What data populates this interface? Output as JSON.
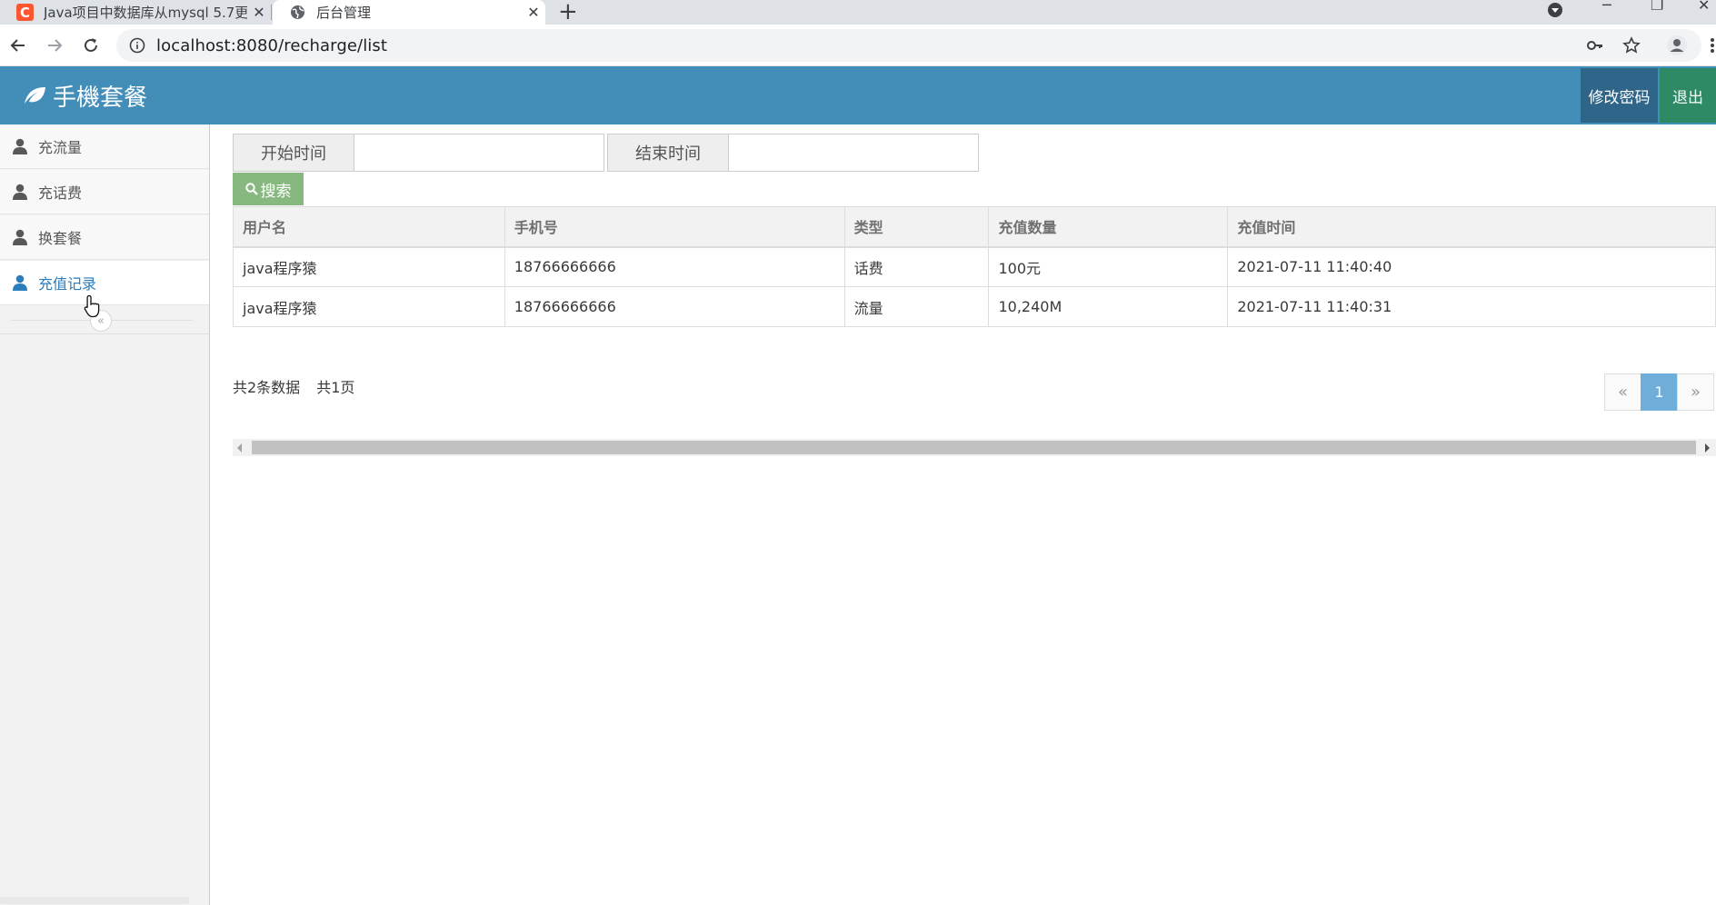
{
  "browser": {
    "tabs": [
      {
        "title": "Java项目中数据库从mysql 5.7更",
        "active": false
      },
      {
        "title": "后台管理",
        "active": true
      }
    ],
    "url": "localhost:8080/recharge/list"
  },
  "header": {
    "brand": "手機套餐",
    "change_password": "修改密码",
    "logout": "退出",
    "colors": {
      "bar": "#438eb9",
      "pwd": "#2e6589",
      "exit": "#2e8965"
    }
  },
  "sidebar": {
    "items": [
      {
        "label": "充流量",
        "active": false
      },
      {
        "label": "充话费",
        "active": false
      },
      {
        "label": "换套餐",
        "active": false
      },
      {
        "label": "充值记录",
        "active": true
      }
    ]
  },
  "search": {
    "start_label": "开始时间",
    "start_value": "",
    "end_label": "结束时间",
    "end_value": "",
    "button": "搜索"
  },
  "table": {
    "headers": [
      "用户名",
      "手机号",
      "类型",
      "充值数量",
      "充值时间"
    ],
    "rows": [
      [
        "java程序猿",
        "18766666666",
        "话费",
        "100元",
        "2021-07-11 11:40:40"
      ],
      [
        "java程序猿",
        "18766666666",
        "流量",
        "10,240M",
        "2021-07-11 11:40:31"
      ]
    ]
  },
  "pagination": {
    "total_records": "共2条数据",
    "total_pages": "共1页",
    "prev": "«",
    "current": "1",
    "next": "»"
  }
}
